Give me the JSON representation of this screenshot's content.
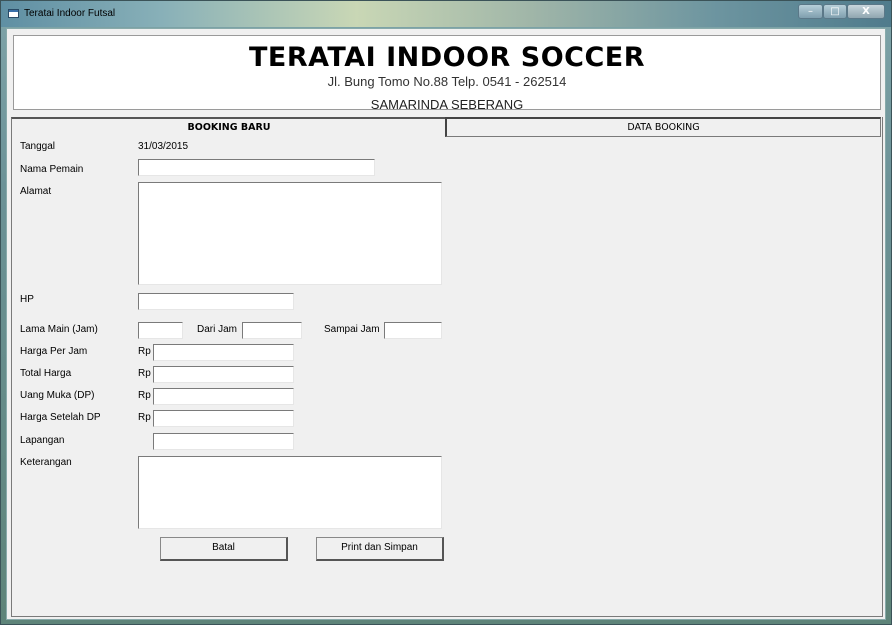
{
  "window": {
    "title": "Teratai Indoor Futsal",
    "controls": {
      "minimize": "–",
      "maximize": "□",
      "close": "X"
    }
  },
  "header": {
    "title": "TERATAI INDOOR SOCCER",
    "address": "Jl. Bung Tomo No.88 Telp. 0541 - 262514",
    "city": "SAMARINDA SEBERANG"
  },
  "tabs": {
    "booking_baru": "BOOKING BARU",
    "data_booking": "DATA BOOKING"
  },
  "form": {
    "tanggal_label": "Tanggal",
    "tanggal_value": "31/03/2015",
    "nama_label": "Nama Pemain",
    "alamat_label": "Alamat",
    "hp_label": "HP",
    "lama_label": "Lama Main (Jam)",
    "dari_label": "Dari Jam",
    "sampai_label": "Sampai Jam",
    "harga_label": "Harga Per Jam",
    "total_label": "Total Harga",
    "dp_label": "Uang Muka (DP)",
    "setelah_label": "Harga Setelah DP",
    "lapangan_label": "Lapangan",
    "keterangan_label": "Keterangan",
    "currency": "Rp"
  },
  "buttons": {
    "batal": "Batal",
    "print": "Print dan Simpan"
  }
}
